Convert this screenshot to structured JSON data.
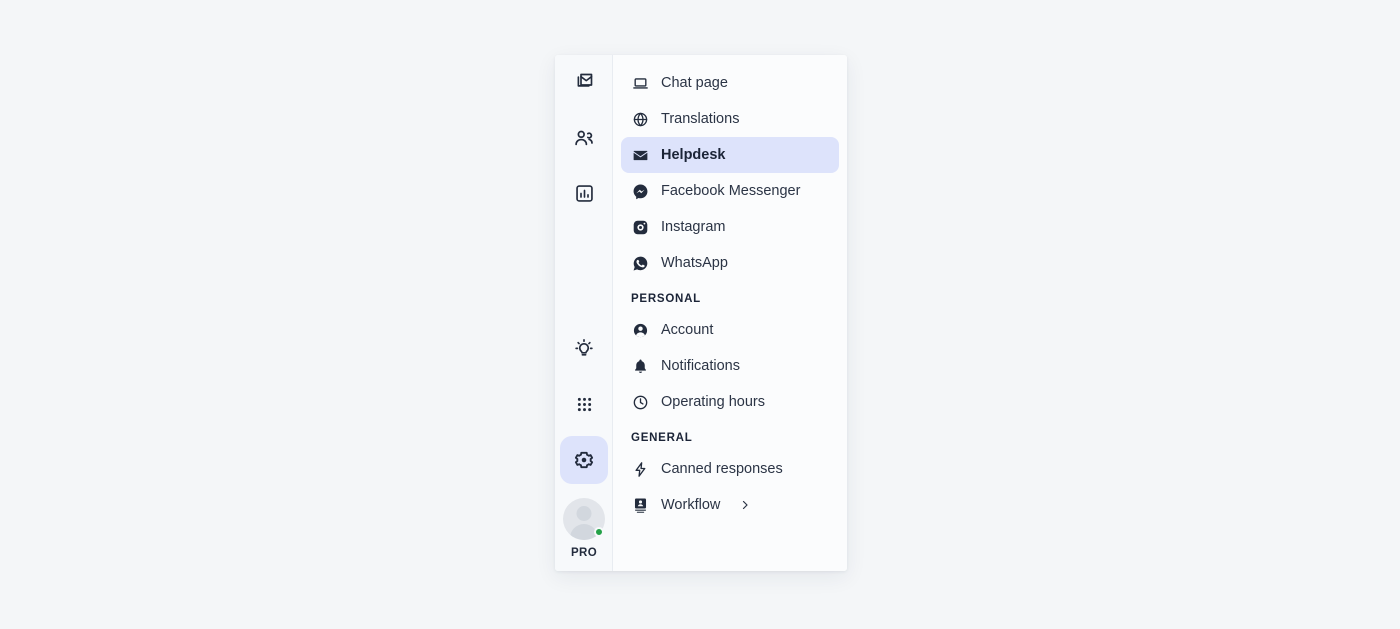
{
  "colors": {
    "page_background": "#f4f6f8",
    "panel_background": "#fbfcfd",
    "rail_background": "#f7f9fb",
    "selection_highlight": "#dde3fb",
    "text_primary": "#2b3445",
    "icon_color": "#232c3d",
    "presence_online": "#24a148"
  },
  "rail": {
    "items": [
      {
        "name": "inbox-icon",
        "label": "Inbox",
        "active": false
      },
      {
        "name": "contacts-icon",
        "label": "Contacts",
        "active": false
      },
      {
        "name": "reports-icon",
        "label": "Reports",
        "active": false
      },
      {
        "name": "lightbulb-icon",
        "label": "Tips",
        "active": false
      },
      {
        "name": "apps-grid-icon",
        "label": "Apps",
        "active": false
      },
      {
        "name": "gear-icon",
        "label": "Settings",
        "active": true
      }
    ],
    "account": {
      "plan_badge": "PRO",
      "status": "online"
    }
  },
  "menu": {
    "top_items": [
      {
        "icon": "laptop-icon",
        "label": "Chat page",
        "selected": false
      },
      {
        "icon": "globe-icon",
        "label": "Translations",
        "selected": false
      },
      {
        "icon": "envelope-icon",
        "label": "Helpdesk",
        "selected": true
      },
      {
        "icon": "facebook-messenger-icon",
        "label": "Facebook Messenger",
        "selected": false
      },
      {
        "icon": "instagram-icon",
        "label": "Instagram",
        "selected": false
      },
      {
        "icon": "whatsapp-icon",
        "label": "WhatsApp",
        "selected": false
      }
    ],
    "personal": {
      "heading": "PERSONAL",
      "items": [
        {
          "icon": "user-circle-icon",
          "label": "Account"
        },
        {
          "icon": "bell-icon",
          "label": "Notifications"
        },
        {
          "icon": "clock-icon",
          "label": "Operating hours"
        }
      ]
    },
    "general": {
      "heading": "GENERAL",
      "items": [
        {
          "icon": "lightning-bolt-icon",
          "label": "Canned responses",
          "has_chevron": false
        },
        {
          "icon": "workflow-card-icon",
          "label": "Workflow",
          "has_chevron": true
        }
      ]
    }
  }
}
